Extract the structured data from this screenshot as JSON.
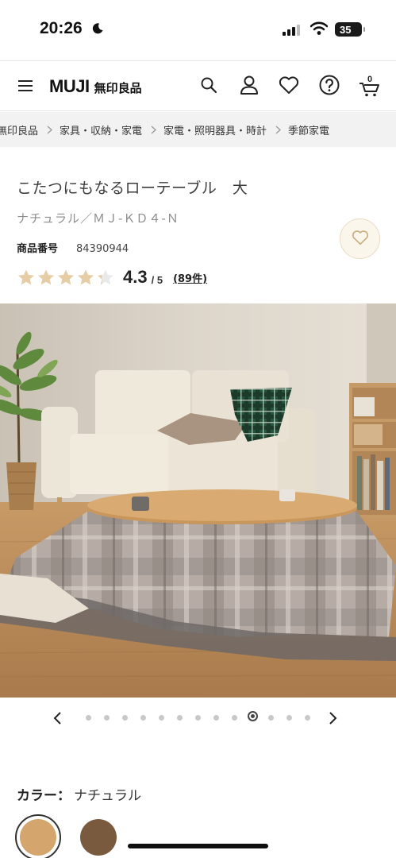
{
  "status_bar": {
    "time": "20:26",
    "battery": "35",
    "icons": [
      "moon-icon",
      "signal-icon",
      "wifi-icon",
      "battery-icon"
    ]
  },
  "header": {
    "logo_en": "MUJI",
    "logo_jp": "無印良品",
    "icons": [
      "menu-icon",
      "search-icon",
      "account-icon",
      "favorites-icon",
      "help-icon",
      "cart-icon"
    ],
    "cart_count": "0"
  },
  "breadcrumb": {
    "items": [
      "無印良品",
      "家具・収納・家電",
      "家電・照明器具・時計",
      "季節家電"
    ]
  },
  "product": {
    "title": "こたつにもなるローテーブル　大",
    "variant": "ナチュラル／ＭＪ-ＫＤ４-Ｎ",
    "code_label": "商品番号",
    "code_value": "84390944",
    "rating": 4.3,
    "rating_text": "4.3",
    "rating_max": "/ 5",
    "review_count": "(89件)",
    "stars_filled_fraction": 0.86
  },
  "carousel": {
    "total": 13,
    "active_index": 9
  },
  "color": {
    "label": "カラー：",
    "value": "ナチュラル",
    "swatches": [
      {
        "name": "ナチュラル",
        "hex": "#d4a56c",
        "selected": true
      },
      {
        "name": "ブラウン",
        "hex": "#7a5a3e",
        "selected": false
      }
    ]
  },
  "colors": {
    "star": "#e6cda6",
    "star_empty": "#e9e9e9",
    "accent_fav_bg": "#fbf6ec"
  }
}
